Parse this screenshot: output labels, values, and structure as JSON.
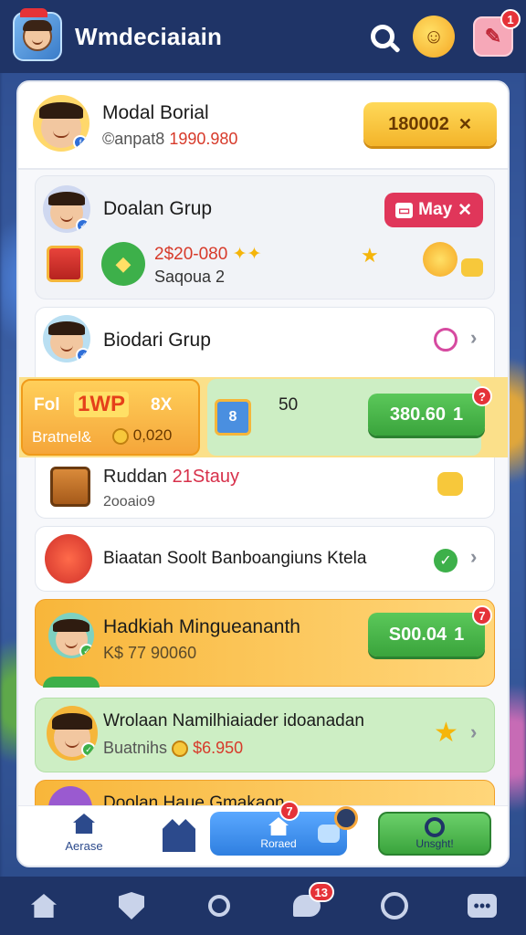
{
  "header": {
    "title": "Wmdeciaiain",
    "gift_badge": "1"
  },
  "top_card": {
    "name": "Modal Borial",
    "sub_prefix": "©anpat8",
    "sub_value": "1990.980",
    "button_label": "180002",
    "button_icon": "✕"
  },
  "group1": {
    "title": "Doalan Grup",
    "button_label": "May",
    "button_icon": "✕",
    "value": "2$20-080",
    "stars": "✦✦",
    "sub": "Saqoua 2"
  },
  "group2": {
    "title": "Biodari Grup",
    "left_banner": {
      "a": "Fol",
      "b": "1WP",
      "c": "8X",
      "d": "Bratnel&",
      "e": "0,020"
    },
    "mid_value": "50",
    "mid_box_text": "8",
    "button_label": "380.60",
    "button_suffix": "1",
    "button_badge": "?",
    "row_title_a": "Ruddan",
    "row_title_b": "21Stauy",
    "row_sub": "2ooaio9"
  },
  "row3": {
    "title": "Biaatan Soolt Banboangiuns Ktela"
  },
  "row4": {
    "title": "Hadkiah Mingueananth",
    "sub": "K$ 77 90060",
    "button_label": "S00.04",
    "button_suffix": "1",
    "button_badge": "7"
  },
  "row5": {
    "title": "Wrolaan Namilhiaiader idoanadan",
    "sub_prefix": "Buatnihs",
    "sub_value": "$6.950"
  },
  "row6": {
    "title": "Doolan Haue Gmakaon"
  },
  "panel_nav": {
    "home_label": "Aerase",
    "center_label": "Roraed",
    "center_badge": "7",
    "right_label": "Unsght!"
  },
  "bottom_nav": {
    "chat_badge": "13"
  },
  "colors": {
    "header_bg": "#1f3467",
    "yellow_button": "#f7c83b",
    "green_button": "#49b34a",
    "red_button": "#e0365a",
    "orange_row": "#f7b23b",
    "green_row": "#c8ebc0"
  }
}
